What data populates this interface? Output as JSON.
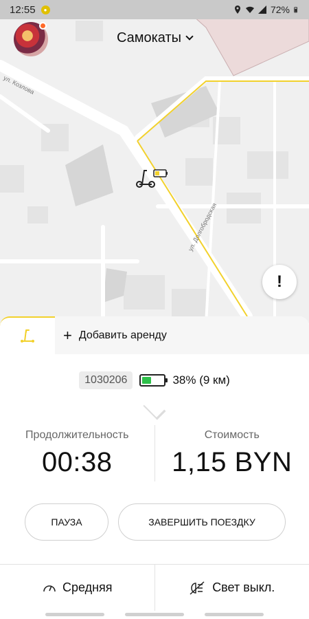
{
  "status_bar": {
    "time": "12:55",
    "battery": "72%"
  },
  "header": {
    "vehicle_type": "Самокаты"
  },
  "map": {
    "street_1": "ул. Козлова",
    "street_2": "ул. Долгобродская",
    "warning_icon": "!"
  },
  "tabs": {
    "add_rental": "Добавить аренду"
  },
  "rental": {
    "scooter_id": "1030206",
    "battery_percent": 38,
    "battery_text": "38% (9 км)",
    "duration_label": "Продолжительность",
    "duration_value": "00:38",
    "cost_label": "Стоимость",
    "cost_value": "1,15 BYN"
  },
  "actions": {
    "pause": "ПАУЗА",
    "finish": "ЗАВЕРШИТЬ ПОЕЗДКУ"
  },
  "bottom_bar": {
    "speed_mode": "Средняя",
    "light": "Свет выкл."
  },
  "colors": {
    "accent": "#f2d12c",
    "battery_fill": "#2ec04a"
  }
}
